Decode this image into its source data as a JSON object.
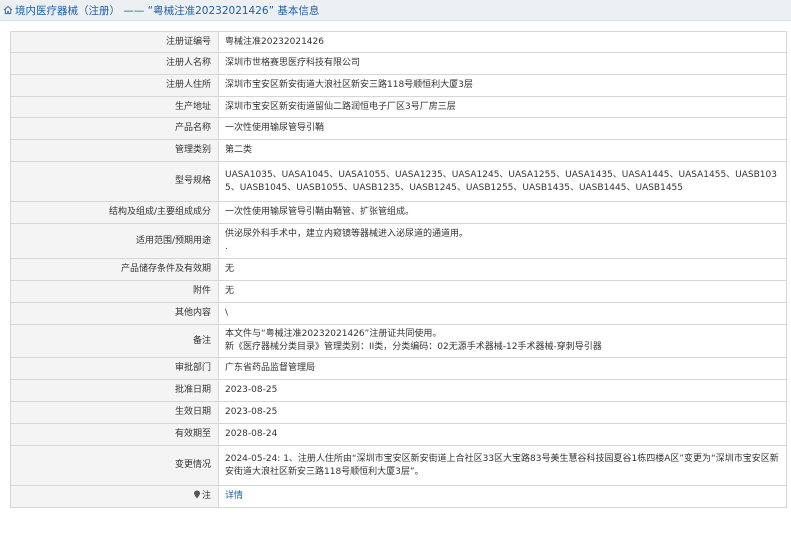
{
  "header": {
    "title": "境内医疗器械（注册） —— “粤械注准20232021426” 基本信息"
  },
  "rows": [
    {
      "label": "注册证编号",
      "value": "粤械注准20232021426"
    },
    {
      "label": "注册人名称",
      "value": "深圳市世格赛思医疗科技有限公司"
    },
    {
      "label": "注册人住所",
      "value": "深圳市宝安区新安街道大浪社区新安三路118号顺恒利大厦3层"
    },
    {
      "label": "生产地址",
      "value": "深圳市宝安区新安街道留仙二路润恒电子厂区3号厂房三层"
    },
    {
      "label": "产品名称",
      "value": "一次性使用输尿管导引鞘"
    },
    {
      "label": "管理类别",
      "value": "第二类"
    },
    {
      "label": "型号规格",
      "value": "UASA1035、UASA1045、UASA1055、UASA1235、UASA1245、UASA1255、UASA1435、UASA1445、UASA1455、UASB1035、UASB1045、UASB1055、UASB1235、UASB1245、UASB1255、UASB1435、UASB1445、UASB1455"
    },
    {
      "label": "结构及组成/主要组成成分",
      "value": "一次性使用输尿管导引鞘由鞘管、扩张管组成。"
    },
    {
      "label": "适用范围/预期用途",
      "lines": [
        "供泌尿外科手术中，建立内窥镜等器械进入泌尿道的通道用。",
        "."
      ]
    },
    {
      "label": "产品储存条件及有效期",
      "value": "无"
    },
    {
      "label": "附件",
      "value": "无"
    },
    {
      "label": "其他内容",
      "value": "\\"
    },
    {
      "label": "备注",
      "lines": [
        "本文件与“粤械注准20232021426”注册证共同使用。",
        "新《医疗器械分类目录》管理类别：II类，分类编码：02无源手术器械-12手术器械-穿刺导引器"
      ]
    },
    {
      "label": "审批部门",
      "value": "广东省药品监督管理局"
    },
    {
      "label": "批准日期",
      "value": "2023-08-25"
    },
    {
      "label": "生效日期",
      "value": "2023-08-25"
    },
    {
      "label": "有效期至",
      "value": "2028-08-24"
    },
    {
      "label": "变更情况",
      "value": "2024-05-24: 1、注册人住所由“深圳市宝安区新安街道上合社区33区大宝路83号美生慧谷科技园夏谷1栋四楼A区”变更为“深圳市宝安区新安街道大浪社区新安三路118号顺恒利大厦3层”。"
    },
    {
      "label": "注",
      "value": "详情",
      "link": true
    }
  ]
}
